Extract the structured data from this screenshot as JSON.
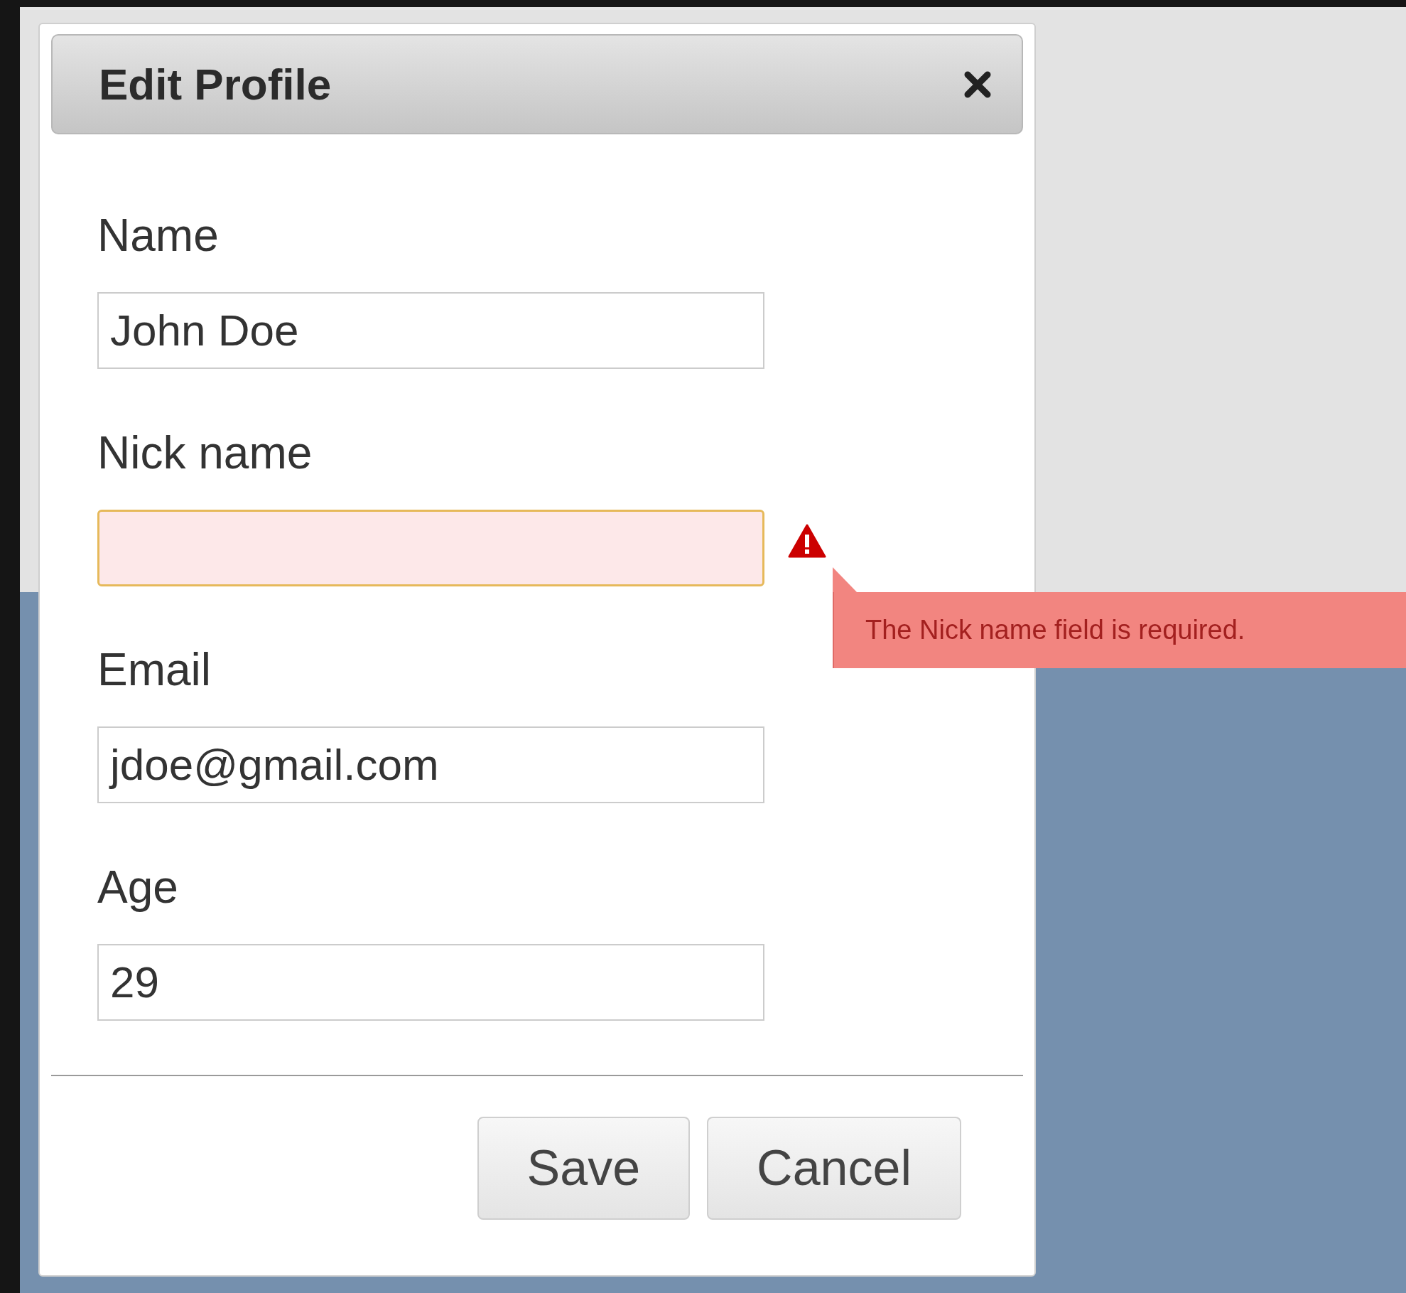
{
  "dialog": {
    "title": "Edit Profile"
  },
  "fields": [
    {
      "label": "Name",
      "value": "John Doe",
      "invalid": false
    },
    {
      "label": "Nick name",
      "invalid": true
    },
    {
      "label": "Email",
      "value": "jdoe@gmail.com",
      "invalid": false
    },
    {
      "label": "Age",
      "value": "29",
      "invalid": false
    }
  ],
  "error_tooltip": {
    "text": "The Nick name field is required."
  },
  "buttons": [
    "Save",
    "Cancel"
  ]
}
